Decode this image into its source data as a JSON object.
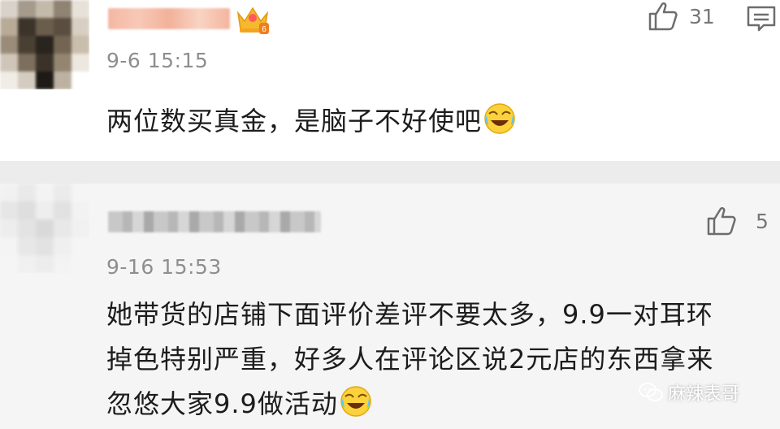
{
  "comments": [
    {
      "time": "9-6 15:15",
      "text": "两位数买真金，是脑子不好使吧",
      "emoji": "cry-laugh-emoji",
      "likes": "31",
      "badge_level": "6"
    },
    {
      "time": "9-16 15:53",
      "text_lines": [
        "她带货的店铺下面评价差评不要太多，9.9一对耳环",
        "掉色特别严重，好多人在评论区说2元店的东西拿来",
        "忽悠大家9.9做活动"
      ],
      "emoji": "cry-laugh-emoji",
      "likes": "5"
    }
  ],
  "watermark": {
    "text": "麻辣表哥",
    "icon": "wechat-icon"
  },
  "colors": {
    "time_gray": "#8e8e8e",
    "separator": "#ececec",
    "card2_bg": "#f5f5f5",
    "crown_gold": "#f5b82e"
  }
}
